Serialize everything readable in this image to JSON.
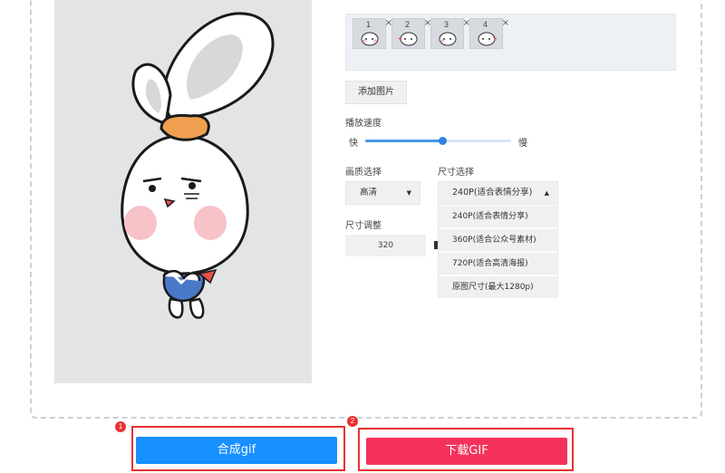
{
  "frames": [
    {
      "number": "1",
      "close": "×"
    },
    {
      "number": "2",
      "close": "×"
    },
    {
      "number": "3",
      "close": "×"
    },
    {
      "number": "4",
      "close": "×"
    }
  ],
  "add_image_label": "添加图片",
  "speed": {
    "label": "播放速度",
    "fast_label": "快",
    "slow_label": "慢",
    "value_fraction": 0.53
  },
  "quality": {
    "label": "画质选择",
    "selected": "高清"
  },
  "size": {
    "label": "尺寸选择",
    "selected": "240P(适合表情分享)",
    "options": [
      "240P(适合表情分享)",
      "360P(适合公众号素材)",
      "720P(适合高清海报)",
      "原图尺寸(最大1280p)"
    ]
  },
  "resize": {
    "label": "尺寸调整",
    "value": "320"
  },
  "actions": {
    "compose_label": "合成gif",
    "compose_badge": "1",
    "download_label": "下载GIF",
    "download_badge": "2"
  },
  "colors": {
    "compose_button": "#1890ff",
    "download_button": "#f5325c",
    "highlight_frame": "#e8312f",
    "slider": "#2c82e0"
  }
}
